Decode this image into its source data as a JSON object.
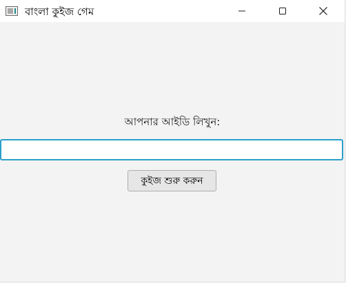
{
  "window": {
    "title": "বাংলা কুইজ গেম",
    "icon": "app-window-icon",
    "controls": {
      "minimize_icon": "minimize-icon",
      "maximize_icon": "maximize-icon",
      "close_icon": "close-icon"
    }
  },
  "form": {
    "prompt_label": "আপনার আইডি লিখুন:",
    "id_input_value": "",
    "start_button_label": "কুইজ শুরু করুন"
  },
  "colors": {
    "background": "#f3f3f3",
    "titlebar": "#ffffff",
    "input_focus_border": "#2a9ec9",
    "button_background": "#e6e6e6"
  }
}
